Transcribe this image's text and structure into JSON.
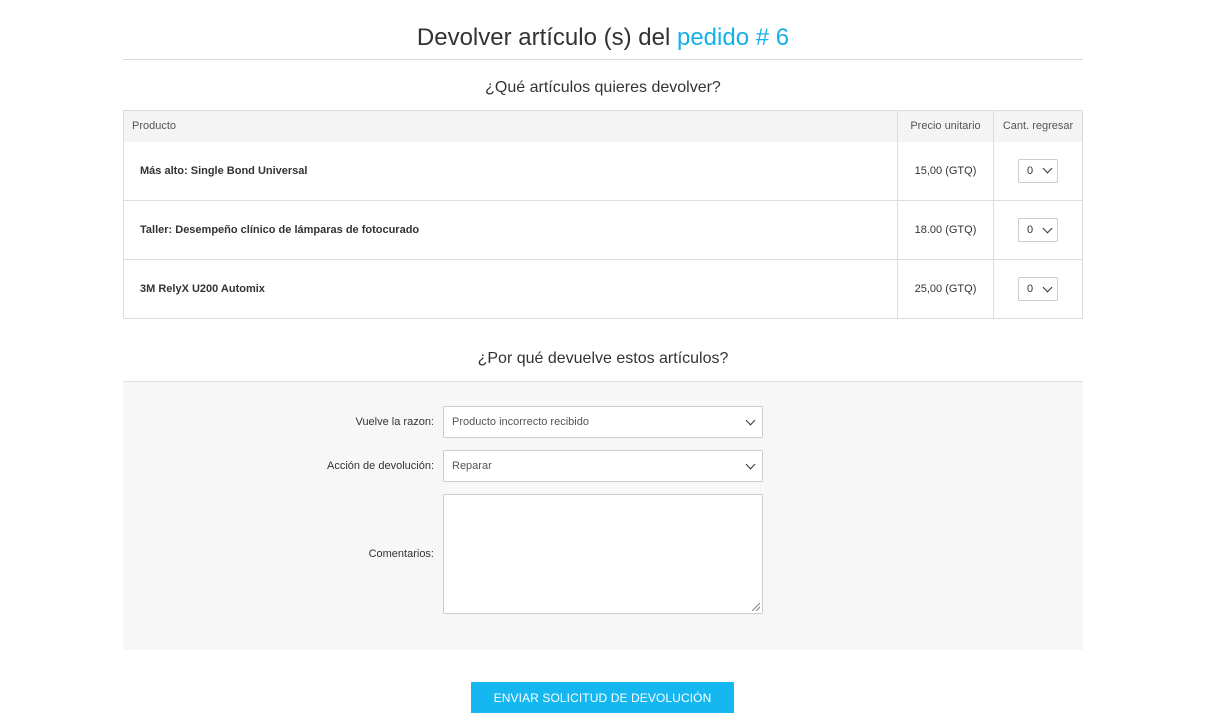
{
  "page": {
    "title_prefix": "Devolver artículo (s) del",
    "title_link": "pedido # 6",
    "accent_color": "#15b0e6",
    "button_color": "#15b7f0"
  },
  "items_section": {
    "heading": "¿Qué artículos quieres devolver?",
    "columns": {
      "product": "Producto",
      "unit_price": "Precio unitario",
      "qty_return": "Cant. regresar"
    },
    "rows": [
      {
        "product": "Más alto: Single Bond Universal",
        "price": "15,00 (GTQ)",
        "qty": "0"
      },
      {
        "product": "Taller: Desempeño clínico de lámparas de fotocurado",
        "price": "18.00 (GTQ)",
        "qty": "0"
      },
      {
        "product": "3M RelyX U200 Automix",
        "price": "25,00 (GTQ)",
        "qty": "0"
      }
    ]
  },
  "reason_section": {
    "heading": "¿Por qué devuelve estos artículos?",
    "reason_label": "Vuelve la razon:",
    "reason_value": "Producto incorrecto recibido",
    "action_label": "Acción de devolución:",
    "action_value": "Reparar",
    "comments_label": "Comentarios:"
  },
  "submit": {
    "label": "ENVIAR SOLICITUD DE DEVOLUCIÓN"
  }
}
